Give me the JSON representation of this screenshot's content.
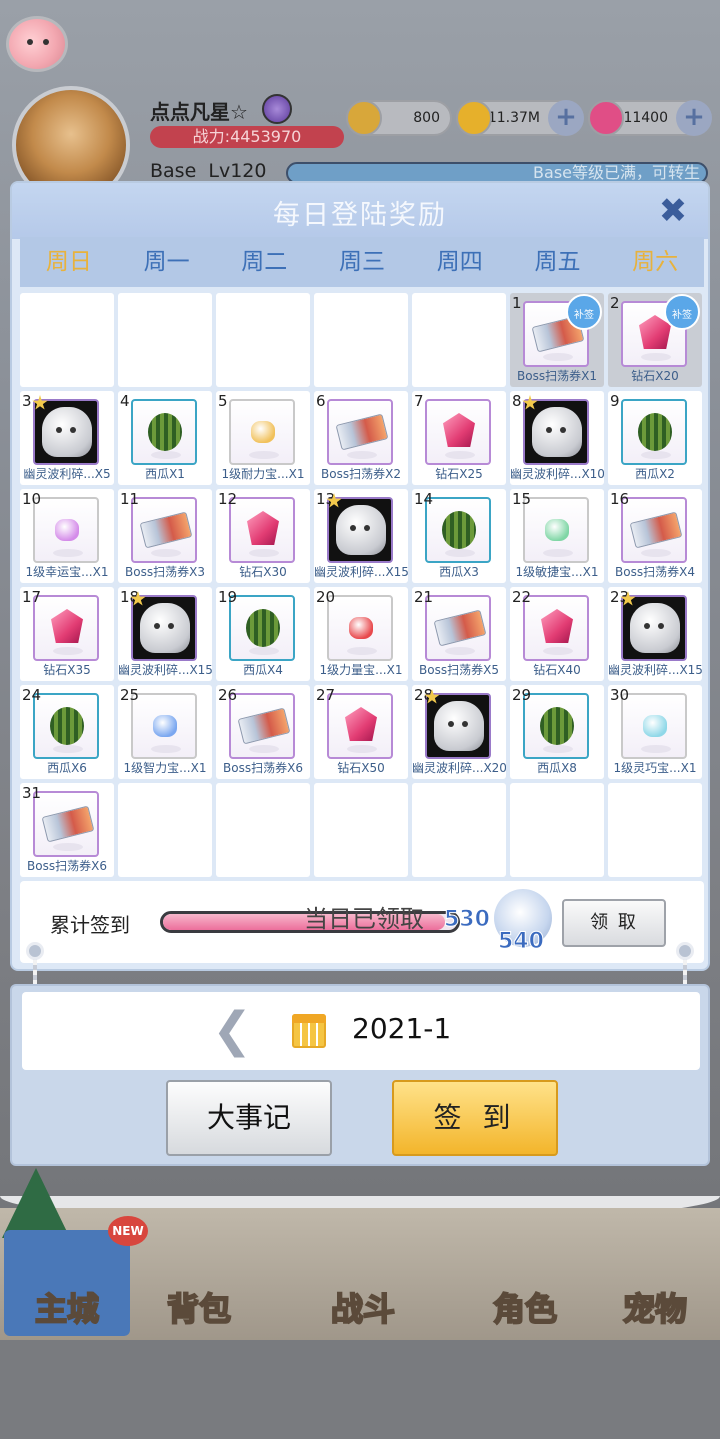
{
  "hud": {
    "player_name": "点点凡星☆",
    "power": "战力:4453970",
    "base_label": "Base",
    "level": "Lv120",
    "base_bar_text": "Base等级已满，可转生",
    "resources": [
      {
        "name": "zeny-coin-icon",
        "value": "800",
        "color": "#d8a73a"
      },
      {
        "name": "gold-pouch-icon",
        "value": "11.37M",
        "color": "#e6b02b"
      },
      {
        "name": "diamond-icon",
        "value": "11400",
        "color": "#e04e86"
      }
    ]
  },
  "modal": {
    "title": "每日登陆奖励",
    "close_icon": "close-icon",
    "weekdays": [
      "周日",
      "周一",
      "周二",
      "周三",
      "周四",
      "周五",
      "周六"
    ],
    "claimed_overlay": "当日已领取",
    "cells": [
      {
        "day": "",
        "label": ""
      },
      {
        "day": "",
        "label": ""
      },
      {
        "day": "",
        "label": ""
      },
      {
        "day": "",
        "label": ""
      },
      {
        "day": "",
        "label": ""
      },
      {
        "day": "1",
        "label": "Boss扫荡券X1",
        "item": "ticket",
        "dim": true,
        "badge": "补签"
      },
      {
        "day": "2",
        "label": "钻石X20",
        "item": "gem",
        "dim": true,
        "badge": "补签"
      },
      {
        "day": "3",
        "label": "幽灵波利碎...X5",
        "item": "ghost",
        "star": true
      },
      {
        "day": "4",
        "label": "西瓜X1",
        "item": "melon"
      },
      {
        "day": "5",
        "label": "1级耐力宝...X1",
        "item": "stone",
        "stone_color": "#f1c15b"
      },
      {
        "day": "6",
        "label": "Boss扫荡券X2",
        "item": "ticket"
      },
      {
        "day": "7",
        "label": "钻石X25",
        "item": "gem"
      },
      {
        "day": "8",
        "label": "幽灵波利碎...X10",
        "item": "ghost",
        "star": true
      },
      {
        "day": "9",
        "label": "西瓜X2",
        "item": "melon"
      },
      {
        "day": "10",
        "label": "1级幸运宝...X1",
        "item": "stone",
        "stone_color": "#d48be9"
      },
      {
        "day": "11",
        "label": "Boss扫荡券X3",
        "item": "ticket"
      },
      {
        "day": "12",
        "label": "钻石X30",
        "item": "gem"
      },
      {
        "day": "13",
        "label": "幽灵波利碎...X15",
        "item": "ghost",
        "star": true
      },
      {
        "day": "14",
        "label": "西瓜X3",
        "item": "melon"
      },
      {
        "day": "15",
        "label": "1级敏捷宝...X1",
        "item": "stone",
        "stone_color": "#7fd6a5"
      },
      {
        "day": "16",
        "label": "Boss扫荡券X4",
        "item": "ticket"
      },
      {
        "day": "17",
        "label": "钻石X35",
        "item": "gem"
      },
      {
        "day": "18",
        "label": "幽灵波利碎...X15",
        "item": "ghost",
        "star": true
      },
      {
        "day": "19",
        "label": "西瓜X4",
        "item": "melon"
      },
      {
        "day": "20",
        "label": "1级力量宝...X1",
        "item": "stone",
        "stone_color": "#e8484c"
      },
      {
        "day": "21",
        "label": "Boss扫荡券X5",
        "item": "ticket"
      },
      {
        "day": "22",
        "label": "钻石X40",
        "item": "gem"
      },
      {
        "day": "23",
        "label": "幽灵波利碎...X15",
        "item": "ghost",
        "star": true
      },
      {
        "day": "24",
        "label": "西瓜X6",
        "item": "melon"
      },
      {
        "day": "25",
        "label": "1级智力宝...X1",
        "item": "stone",
        "stone_color": "#7aa7f0"
      },
      {
        "day": "26",
        "label": "Boss扫荡券X6",
        "item": "ticket"
      },
      {
        "day": "27",
        "label": "钻石X50",
        "item": "gem"
      },
      {
        "day": "28",
        "label": "幽灵波利碎...X20",
        "item": "ghost",
        "star": true
      },
      {
        "day": "29",
        "label": "西瓜X8",
        "item": "melon"
      },
      {
        "day": "30",
        "label": "1级灵巧宝...X1",
        "item": "stone",
        "stone_color": "#8fd8e8"
      },
      {
        "day": "31",
        "label": "Boss扫荡券X6",
        "item": "ticket"
      },
      {
        "day": "",
        "label": ""
      },
      {
        "day": "",
        "label": ""
      },
      {
        "day": "",
        "label": ""
      },
      {
        "day": "",
        "label": ""
      },
      {
        "day": "",
        "label": ""
      },
      {
        "day": "",
        "label": ""
      }
    ],
    "progress": {
      "label": "累计签到",
      "current": "530",
      "next": "540",
      "fraction": 0.96,
      "claim_label": "领 取"
    }
  },
  "panel": {
    "prev_label": "❮",
    "date": "2021-1",
    "log_button": "大事记",
    "sign_button": "签 到"
  },
  "nav": [
    {
      "label": "主城",
      "active": true
    },
    {
      "label": "背包"
    },
    {
      "label": "战斗"
    },
    {
      "label": "角色"
    },
    {
      "label": "宠物"
    }
  ],
  "nav_new_badge": "NEW"
}
